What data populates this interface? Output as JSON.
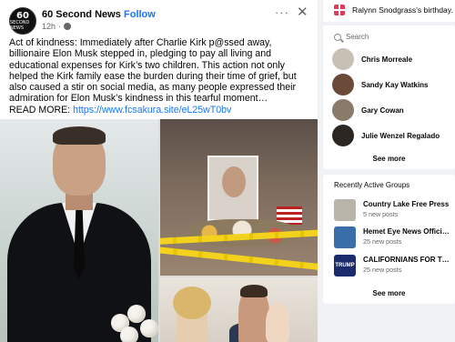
{
  "post": {
    "avatar_line1": "60",
    "avatar_line2": "SECOND NEWS",
    "page_name": "60 Second News",
    "separator": "·",
    "follow_label": "Follow",
    "time": "12h",
    "separator2": "·",
    "more_glyph": "···",
    "close_glyph": "✕",
    "text": "Act of kindness: Immediately after Charlie Kirk p@ssed away, billionaire Elon Musk stepped in, pledging to pay all living and educational expenses for Kirk’s two children. This action not only helped the Kirk family ease the burden during their time of grief, but also caused a stir on social media, as many people expressed their admiration for Elon Musk’s kindness in this tearful moment…",
    "read_more_label": "READ MORE:",
    "link": "https://www.fcsakura.site/eL25wT0bv"
  },
  "sidebar": {
    "birthday_text": "Ralynn Snodgrass's birthday.",
    "search_label": "Search",
    "contacts": [
      {
        "name": "Chris Morreale",
        "color": "#c8c0b4"
      },
      {
        "name": "Sandy Kay Watkins",
        "color": "#6b4a3a"
      },
      {
        "name": "Gary Cowan",
        "color": "#8a7a6a"
      },
      {
        "name": "Julie Wenzel Regalado",
        "color": "#2b2622"
      }
    ],
    "contacts_see_more": "See more",
    "groups_title": "Recently Active Groups",
    "groups": [
      {
        "name": "Country Lake Free Press",
        "sub": "5 new posts",
        "color": "#b8b4aa"
      },
      {
        "name": "Hemet Eye News Official Offi...",
        "sub": "25 new posts",
        "color": "#3a6ea8"
      },
      {
        "name": "CALIFORNIANS FOR TRUMP...",
        "sub": "25 new posts",
        "color": "#1b2a6b",
        "badge": "TRUMP"
      }
    ],
    "groups_see_more": "See more"
  }
}
